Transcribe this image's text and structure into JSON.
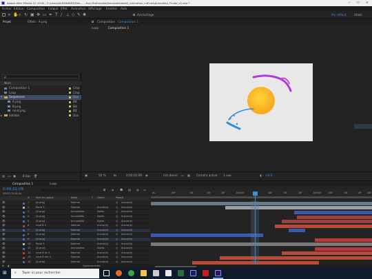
{
  "window": {
    "title": "Adobe After Effects CC 2018 - C:\\Users\\ALEXANDRE\\Des... ...tion Multimedia\\Seconde\\Idealt2_animation_intEcho\\Animation_Fluide_v1.aep *"
  },
  "menu": [
    "Fichier",
    "Édition",
    "Composition",
    "Calque",
    "Effet",
    "Animation",
    "Affichage",
    "Fenêtre",
    "Aide"
  ],
  "toolbar": {
    "snap_label": "Accrochage",
    "workspace": "Par défaut",
    "right": "Standard",
    "user": "Utiwil"
  },
  "project": {
    "tab": "Projet",
    "effects_tab": "Effets : A.png",
    "search_placeholder": "ρ",
    "col_name": "Nom",
    "items": [
      {
        "name": "Composition 1",
        "type": "Cmp",
        "color": "#c8b86a"
      },
      {
        "name": "Loop",
        "type": "Cmp",
        "color": "#c8b86a"
      },
      {
        "name": "Sequences",
        "type": "Dos",
        "color": "#d8c060"
      },
      {
        "name": "A.png",
        "type": "Bit",
        "color": "#c8b86a"
      },
      {
        "name": "B.png",
        "type": "Bit",
        "color": "#c8b86a"
      },
      {
        "name": "rond.png",
        "type": "Bit",
        "color": "#c8b86a"
      },
      {
        "name": "Solides",
        "type": "Dos",
        "color": "#d8c060"
      }
    ],
    "bpc": "8 bpc"
  },
  "viewer": {
    "tab": "Composition",
    "tab_name": "Composition 1",
    "sub_tabs": [
      "Loop",
      "Composition 1"
    ],
    "zoom": "50 %",
    "time": "0:00:01:09",
    "res": "(Un demi)",
    "camera": "Caméra active",
    "views": "1 vue",
    "offset": "+0,0"
  },
  "timeline": {
    "tabs": [
      "Composition 1",
      "Loop"
    ],
    "time": "0:00:01:09",
    "fps": "00033 (25.00 i/s)",
    "col_headers": [
      "#",
      "Nom du calque",
      "Mode",
      "T",
      "Cache",
      "Parent"
    ],
    "ruler": [
      "0s",
      "05f",
      "10f",
      "15f",
      "20f",
      "01:00f",
      "05f",
      "10f",
      "15f",
      "20f",
      "02:00f",
      "05f",
      "10f",
      "15f",
      "20f"
    ],
    "layers": [
      {
        "num": "1",
        "name": "[A.png]",
        "mode": "Normal",
        "cache": "",
        "parent": "Aucun(e)",
        "color": "#4a6aa8"
      },
      {
        "num": "2",
        "name": "Rond 3",
        "mode": "Normal",
        "cache": "Aucun(e)",
        "parent": "Aucun(e)",
        "color": "#b8b8b8"
      },
      {
        "num": "3",
        "name": "[A.png]",
        "mode": "Incrustatio",
        "cache": "Alpha",
        "parent": "Aucun(e)",
        "color": "#4a6aa8"
      },
      {
        "num": "4",
        "name": "[A.png]",
        "mode": "Incrustatio",
        "cache": "Alpha",
        "parent": "Aucun(e)",
        "color": "#4a6aa8"
      },
      {
        "num": "5",
        "name": "[A.png]",
        "mode": "Incrustatio",
        "cache": "Alpha",
        "parent": "Aucun(e)",
        "color": "#4a6aa8"
      },
      {
        "num": "6",
        "name": "rond 8 2",
        "mode": "Normal",
        "cache": "Aucun(e)",
        "parent": "Aucun(e)",
        "color": "#b83a3a"
      },
      {
        "num": "7",
        "name": "[A.png]",
        "mode": "Normal",
        "cache": "Aucun(e)",
        "parent": "Aucun(e)",
        "color": "#4a6aa8"
      },
      {
        "num": "8",
        "name": "[A.png]",
        "mode": "Normal",
        "cache": "Aucun(e)",
        "parent": "Aucun(e)",
        "color": "#4a6aa8"
      },
      {
        "num": "9",
        "name": "[A.png]",
        "mode": "Normal",
        "cache": "Aucun(e)",
        "parent": "Aucun(e)",
        "color": "#4a6aa8"
      },
      {
        "num": "10",
        "name": "Rond 3",
        "mode": "Normal",
        "cache": "Aucun(e)",
        "parent": "Aucun(e)",
        "color": "#b8b8b8"
      },
      {
        "num": "11",
        "name": "[A.png]",
        "mode": "Incrustatio",
        "cache": "Alpha",
        "parent": "Aucun(e)",
        "color": "#4a6aa8"
      },
      {
        "num": "12",
        "name": "rond 8 lis 3",
        "mode": "Normal",
        "cache": "Aucun(e)",
        "parent": "Aucun(e)",
        "color": "#b83a3a"
      },
      {
        "num": "13",
        "name": "rond 8 ext 3",
        "mode": "Normal",
        "cache": "Aucun(e)",
        "parent": "Aucun(e)",
        "color": "#b83a3a"
      },
      {
        "num": "14",
        "name": "[A.png]",
        "mode": "Normal",
        "cache": "Aucun(e)",
        "parent": "Aucun(e)",
        "color": "#4a6aa8"
      }
    ],
    "toggle": "Options/modes"
  },
  "taskbar": {
    "search": "Taper ici pour rechercher"
  }
}
